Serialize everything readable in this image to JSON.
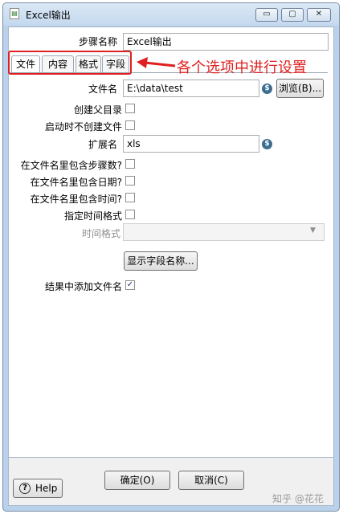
{
  "window": {
    "title": "Excel输出"
  },
  "form": {
    "step_name_label": "步骤名称",
    "step_name_value": "Excel输出",
    "tabs": [
      {
        "label": "文件"
      },
      {
        "label": "内容"
      },
      {
        "label": "格式"
      },
      {
        "label": "字段"
      }
    ],
    "annotation": "各个选项中进行设置",
    "filename_label": "文件名",
    "filename_value": "E:\\data\\test",
    "browse_label": "浏览(B)...",
    "create_parent_label": "创建父目录",
    "no_create_label": "启动时不创建文件",
    "ext_label": "扩展名",
    "ext_value": "xls",
    "include_step_label": "在文件名里包含步骤数?",
    "include_date_label": "在文件名里包含日期?",
    "include_time_label": "在文件名里包含时间?",
    "time_format_flag_label": "指定时间格式",
    "time_format_label": "时间格式",
    "show_fields_label": "显示字段名称...",
    "add_result_label": "结果中添加文件名",
    "add_result_checked": "✓",
    "dollar": "$"
  },
  "footer": {
    "ok_label": "确定(O)",
    "cancel_label": "取消(C)",
    "help_label": "Help",
    "help_icon": "?"
  },
  "watermark": "知乎 @花花",
  "icons": {
    "minimize": "▭",
    "maximize": "▢",
    "close": "✕"
  }
}
